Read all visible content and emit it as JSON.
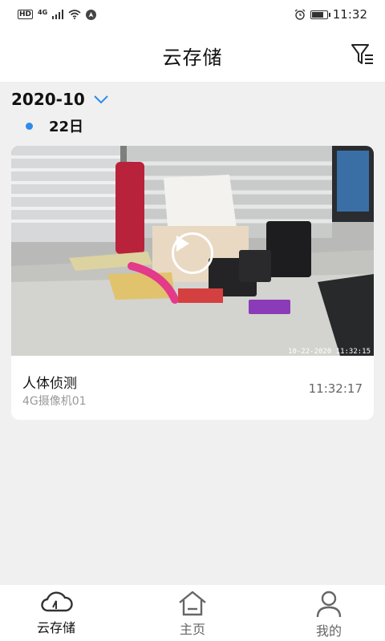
{
  "status_bar": {
    "left_badges": [
      "HD",
      "4G"
    ],
    "time": "11:32",
    "battery_level": 0.75
  },
  "header": {
    "title": "云存储",
    "filter_icon": "filter-icon"
  },
  "timeline": {
    "month": "2020-10",
    "day": "22日",
    "accent_color": "#2d8ceb"
  },
  "records": [
    {
      "title": "人体侦测",
      "camera": "4G摄像机01",
      "time": "11:32:17",
      "thumbnail_stamp": "10-22-2020  11:32:15"
    }
  ],
  "bottom_nav": {
    "items": [
      {
        "label": "云存储",
        "icon": "cloud-icon",
        "active": true
      },
      {
        "label": "主页",
        "icon": "home-icon",
        "active": false
      },
      {
        "label": "我的",
        "icon": "person-icon",
        "active": false
      }
    ]
  }
}
